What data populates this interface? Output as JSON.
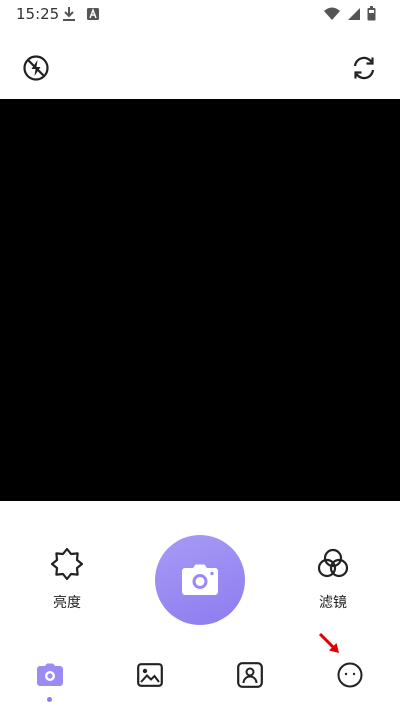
{
  "status_bar": {
    "time": "15:25",
    "icons": [
      "download-icon",
      "a-badge-icon",
      "wifi-icon",
      "signal-icon",
      "battery-icon"
    ]
  },
  "top_controls": {
    "flash_icon": "flash-off-icon",
    "switch_icon": "switch-camera-icon"
  },
  "tools": {
    "brightness_label": "亮度",
    "filter_label": "滤镜"
  },
  "shutter": {
    "icon": "camera-icon"
  },
  "nav": {
    "items": [
      "camera-icon",
      "gallery-icon",
      "portrait-icon",
      "more-icon"
    ],
    "active": "camera-icon"
  },
  "colors": {
    "accent": "#8c7cf0",
    "accent_light": "#a79bf5",
    "preview": "#000000",
    "arrow": "#e00000"
  }
}
